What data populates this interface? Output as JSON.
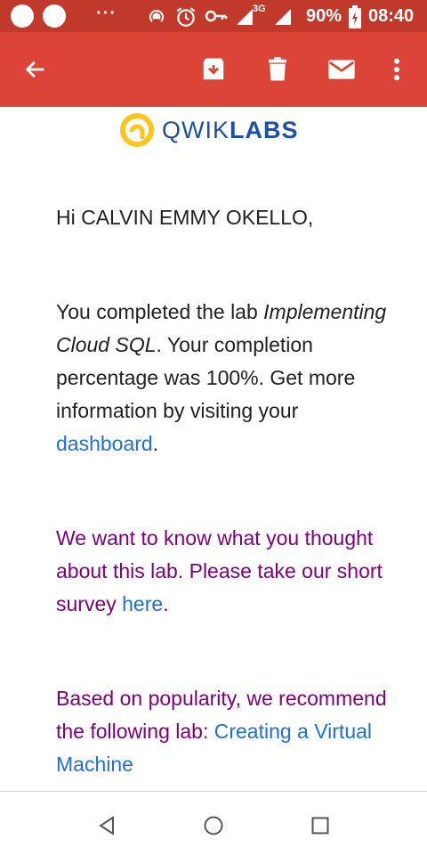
{
  "status_bar": {
    "battery": "90%",
    "time": "08:40",
    "network": "3G",
    "more_indicator": "···"
  },
  "app_bar": {
    "icons": [
      "back-arrow-icon",
      "archive-icon",
      "delete-icon",
      "mark-unread-icon",
      "more-vert-icon"
    ]
  },
  "email": {
    "logo": {
      "text_light": "QWIK",
      "text_bold": "LABS"
    },
    "greeting": "Hi CALVIN EMMY OKELLO,",
    "completion": {
      "line1": "You completed the lab",
      "lab_name": "Implementing Cloud SQL",
      "line2": ". Your completion percentage was 100%. Get more information by visiting your ",
      "link": "dashboard",
      "end": "."
    },
    "survey": {
      "text": "We want to know what you thought about this lab. Please take our short survey ",
      "link": "here",
      "end": "."
    },
    "recommend": {
      "text": "Based on popularity, we recommend the following lab:",
      "link": "Creating a Virtual Machine"
    }
  },
  "colors": {
    "status_bar": "#c0392b",
    "app_bar": "#db4437",
    "purple_text": "#800080",
    "link": "#1e6fd9",
    "logo_ring": "#f9c619"
  },
  "nav_bar": {
    "icons": [
      "back-triangle-icon",
      "home-circle-icon",
      "recents-square-icon"
    ]
  }
}
